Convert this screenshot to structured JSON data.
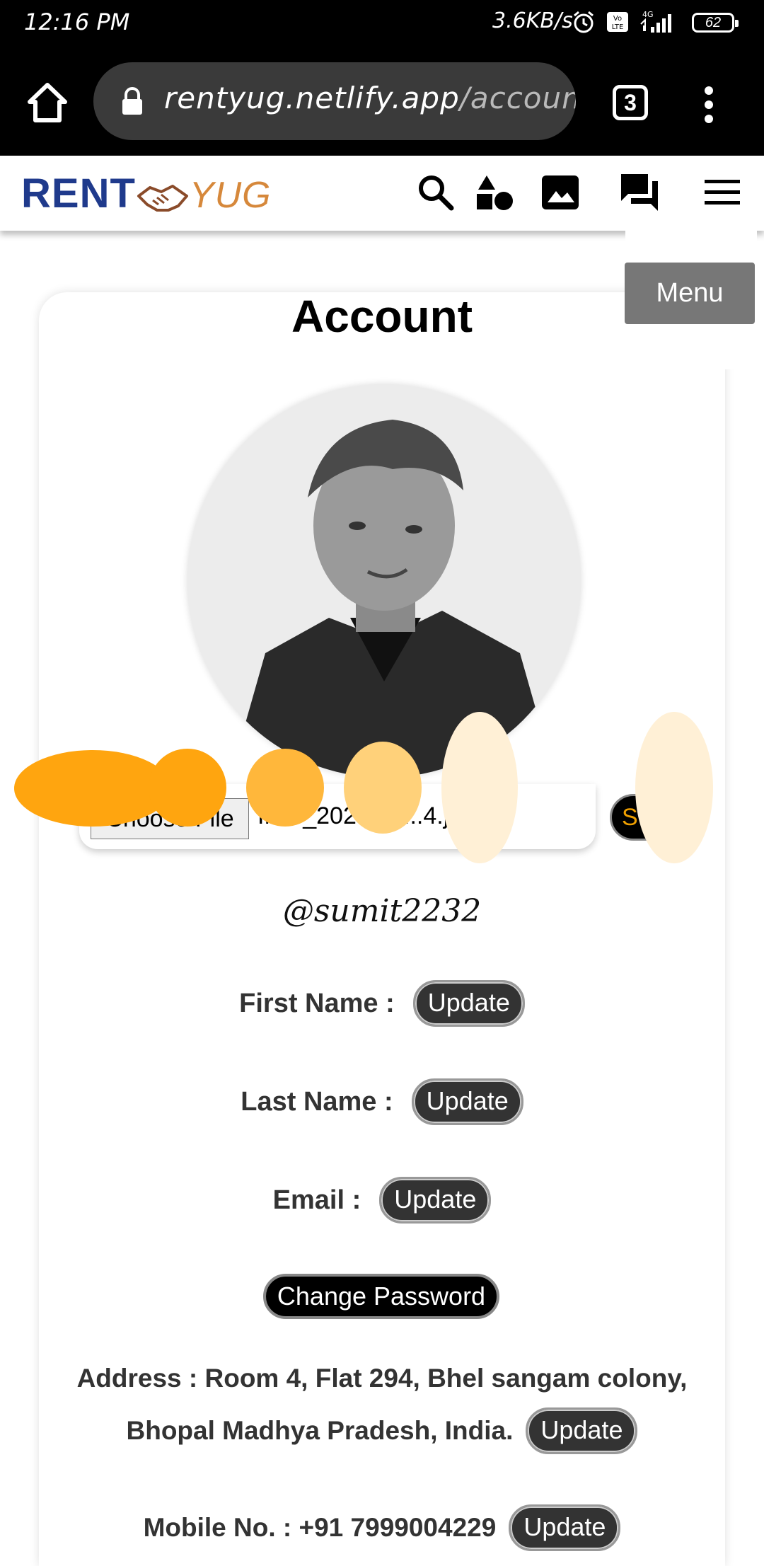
{
  "status_bar": {
    "time": "12:16 PM",
    "speed": "3.6KB/s",
    "network": "4G",
    "battery": "62"
  },
  "browser": {
    "url_domain": "rentyug.netlify.app",
    "url_path": "/account/sui",
    "tab_count": "3"
  },
  "header": {
    "logo_left": "RENT",
    "logo_right": "YUG"
  },
  "menu": {
    "label": "Menu"
  },
  "account": {
    "title": "Account",
    "choose_file_label": "Choose File",
    "file_name": "IMG_202...00...4.jpg",
    "save_label": "S",
    "username": "@sumit2232",
    "fields": {
      "first_name_label": "First Name :",
      "last_name_label": "Last Name :",
      "email_label": "Email :",
      "update_label": "Update"
    },
    "change_password_label": "Change Password",
    "address_line1": "Address : Room 4, Flat 294, Bhel sangam colony,",
    "address_line2": "Bhopal Madhya Pradesh, India.",
    "mobile": "Mobile No. : +91 7999004229"
  },
  "colors": {
    "brand_blue": "#1f3a8c",
    "brand_orange": "#d6883b",
    "blob_orange": "#ffa50f",
    "blob_light": "#ffd17a",
    "blob_cream": "#fff0d6"
  }
}
